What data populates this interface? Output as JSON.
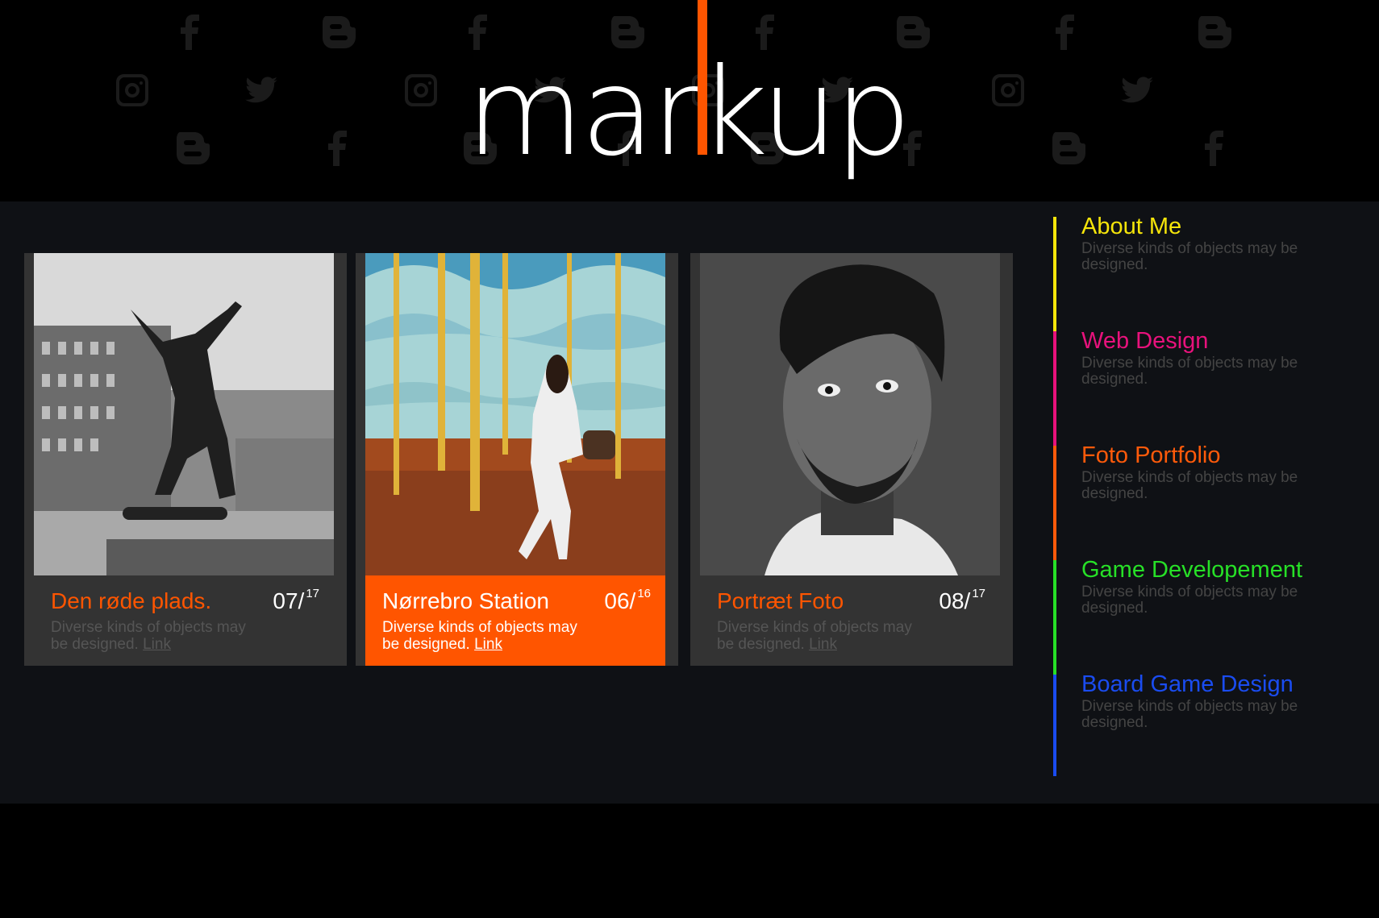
{
  "brand": {
    "logo_text": "markup",
    "accent_color": "#ff5500"
  },
  "background_icons": [
    "facebook-icon",
    "blogger-icon",
    "instagram-icon",
    "twitter-icon"
  ],
  "cards": [
    {
      "title": "Den røde plads.",
      "date_main": "07/",
      "date_sup": "17",
      "desc": "Diverse kinds of objects may be designed.",
      "link": "Link",
      "active": false
    },
    {
      "title": "Nørrebro Station",
      "date_main": "06/",
      "date_sup": "16",
      "desc": "Diverse kinds of objects may be designed.",
      "link": "Link",
      "active": true
    },
    {
      "title": "Portræt Foto",
      "date_main": "08/",
      "date_sup": "17",
      "desc": "Diverse kinds of objects may be designed.",
      "link": "Link",
      "active": false
    }
  ],
  "nav": [
    {
      "label": "About Me",
      "sub": "Diverse kinds of objects may be designed.",
      "color": "#f5e50a"
    },
    {
      "label": "Web Design",
      "sub": "Diverse kinds of objects may be designed.",
      "color": "#e8127c"
    },
    {
      "label": "Foto Portfolio",
      "sub": "Diverse kinds of objects may be designed.",
      "color": "#ff5a0a"
    },
    {
      "label": "Game Developement",
      "sub": "Diverse kinds of objects may be designed.",
      "color": "#27e027"
    },
    {
      "label": "Board Game Design",
      "sub": "Diverse kinds of objects may be designed.",
      "color": "#1a4cf0"
    }
  ]
}
